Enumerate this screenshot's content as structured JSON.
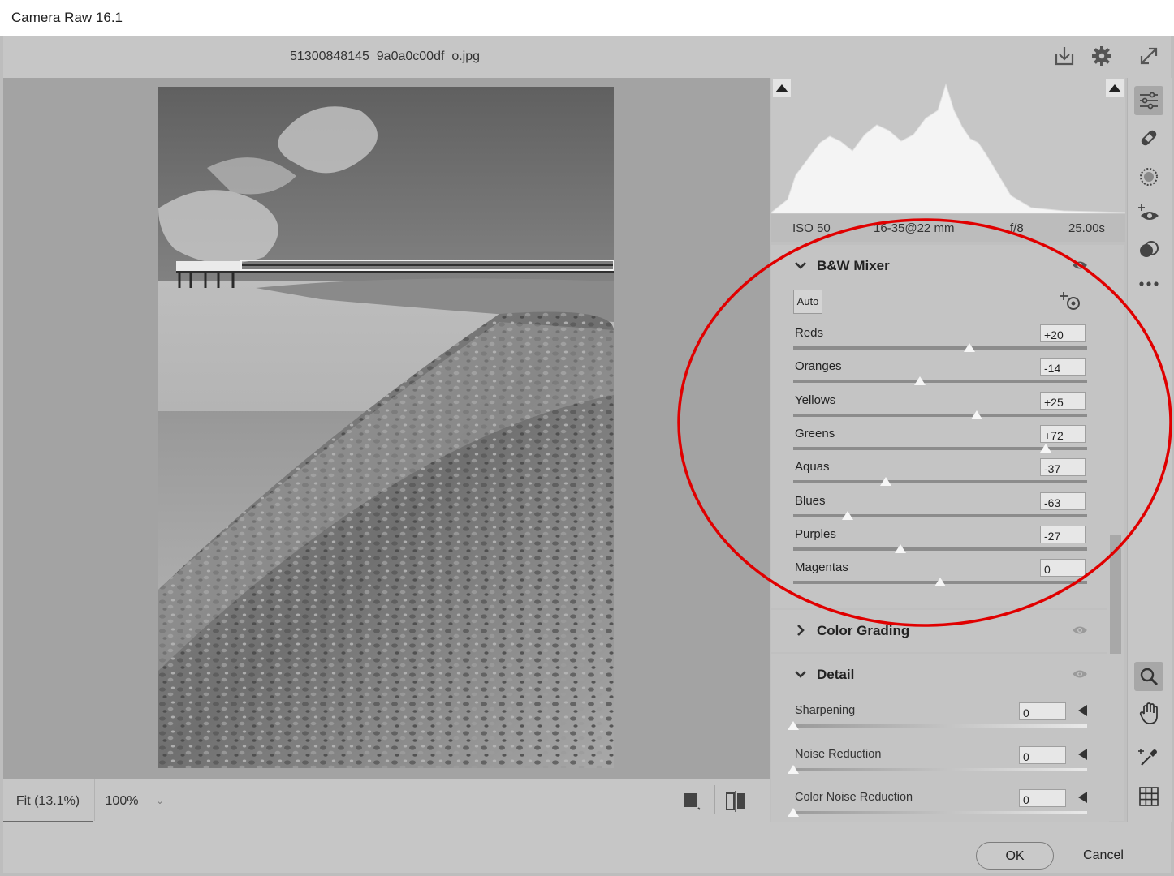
{
  "window": {
    "title": "Camera Raw 16.1"
  },
  "topbar": {
    "filename": "51300848145_9a0a0c00df_o.jpg"
  },
  "exif": {
    "iso": "ISO 50",
    "lens": "16-35@22 mm",
    "aperture": "f/8",
    "shutter": "25.00s"
  },
  "bw_mixer": {
    "title": "B&W Mixer",
    "auto_label": "Auto",
    "sliders": [
      {
        "label": "Reds",
        "value": "+20",
        "level": 20
      },
      {
        "label": "Oranges",
        "value": "-14",
        "level": -14
      },
      {
        "label": "Yellows",
        "value": "+25",
        "level": 25
      },
      {
        "label": "Greens",
        "value": "+72",
        "level": 72
      },
      {
        "label": "Aquas",
        "value": "-37",
        "level": -37
      },
      {
        "label": "Blues",
        "value": "-63",
        "level": -63
      },
      {
        "label": "Purples",
        "value": "-27",
        "level": -27
      },
      {
        "label": "Magentas",
        "value": "0",
        "level": 0
      }
    ]
  },
  "color_grading": {
    "title": "Color Grading"
  },
  "detail": {
    "title": "Detail",
    "sliders": [
      {
        "label": "Sharpening",
        "value": "0",
        "level": 0
      },
      {
        "label": "Noise Reduction",
        "value": "0",
        "level": 0
      },
      {
        "label": "Color Noise Reduction",
        "value": "0",
        "level": 0
      }
    ]
  },
  "bottombar": {
    "zoom_fit": "Fit (13.1%)",
    "zoom_100": "100%"
  },
  "footer": {
    "ok": "OK",
    "cancel": "Cancel"
  },
  "annotation": {
    "color": "#e00000"
  }
}
